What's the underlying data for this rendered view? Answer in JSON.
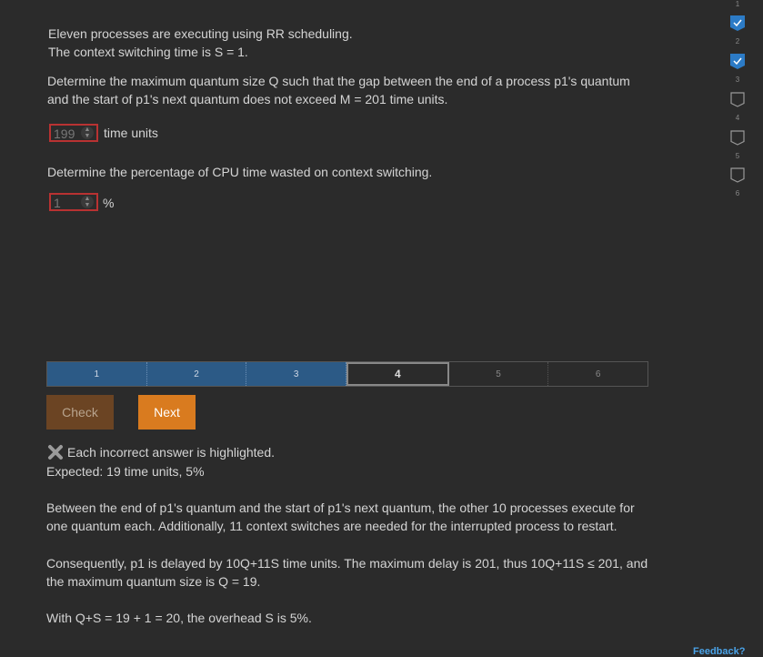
{
  "problem": {
    "intro_line1": "Eleven processes are executing using RR scheduling.",
    "intro_line2": "The context switching time is S = 1.",
    "q1_line1": "Determine the maximum quantum size Q such that the gap between the end of a process p1's quantum",
    "q1_line2": "and the start of p1's next quantum does not exceed M = 201 time units.",
    "q1_value": "199",
    "q1_unit": "time units",
    "q2_text": "Determine the percentage of CPU time wasted on context switching.",
    "q2_value": "1",
    "q2_unit": "%"
  },
  "progress": {
    "segments": [
      "1",
      "2",
      "3",
      "4",
      "5",
      "6"
    ],
    "current": "4"
  },
  "buttons": {
    "check": "Check",
    "next": "Next"
  },
  "feedback": {
    "incorrect": "Each incorrect answer is highlighted.",
    "expected": "Expected: 19 time units, 5%",
    "exp1_line1": "Between the end of p1's quantum and the start of p1's next quantum, the other 10 processes execute for",
    "exp1_line2": "one quantum each. Additionally, 11 context switches are needed for the interrupted process to restart.",
    "exp2_line1": "Consequently, p1 is delayed by 10Q+11S time units. The maximum delay is 201, thus 10Q+11S ≤ 201, and",
    "exp2_line2": "the maximum quantum size is Q = 19.",
    "exp3": "With Q+S = 19 + 1 = 20, the overhead S is 5%."
  },
  "sidebar": {
    "items": [
      {
        "num": "1",
        "state": "complete"
      },
      {
        "num": "2",
        "state": "complete"
      },
      {
        "num": "3",
        "state": "incomplete"
      },
      {
        "num": "4",
        "state": "incomplete"
      },
      {
        "num": "5",
        "state": "incomplete"
      },
      {
        "num": "6",
        "state": "incomplete"
      }
    ],
    "feedback_link": "Feedback?"
  },
  "colors": {
    "accent_blue": "#2c5a86",
    "error_red": "#b83232",
    "next_orange": "#d97b1f",
    "check_brown": "#6b4423"
  }
}
